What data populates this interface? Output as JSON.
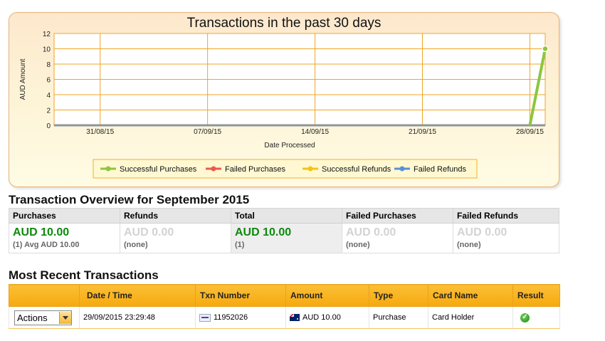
{
  "chart": {
    "title": "Transactions in the past 30 days",
    "ylabel": "AUD Amount",
    "xlabel": "Date Processed",
    "colors": {
      "successful_purchases": "#8cc63e",
      "failed_purchases": "#e85c4a",
      "successful_refunds": "#f5c312",
      "failed_refunds": "#5b8fd6",
      "grid": "#f0a626"
    }
  },
  "chart_data": {
    "type": "line",
    "title": "Transactions in the past 30 days",
    "xlabel": "Date Processed",
    "ylabel": "AUD Amount",
    "ylim": [
      0,
      12
    ],
    "yticks": [
      0,
      2,
      4,
      6,
      8,
      10,
      12
    ],
    "x_tick_labels": [
      "31/08/15",
      "07/09/15",
      "14/09/15",
      "21/09/15",
      "28/09/15"
    ],
    "x_start": "28/08/15",
    "x_end": "29/09/15",
    "grid": true,
    "legend_position": "bottom",
    "series": [
      {
        "name": "Successful Purchases",
        "points": [
          [
            "28/09/15",
            0
          ],
          [
            "29/09/15",
            10
          ]
        ]
      },
      {
        "name": "Failed Purchases",
        "points": [
          [
            "28/08/15",
            0
          ],
          [
            "29/09/15",
            0
          ]
        ]
      },
      {
        "name": "Successful Refunds",
        "points": [
          [
            "28/08/15",
            0
          ],
          [
            "29/09/15",
            0
          ]
        ]
      },
      {
        "name": "Failed Refunds",
        "points": [
          [
            "28/08/15",
            0
          ],
          [
            "29/09/15",
            0
          ]
        ]
      }
    ]
  },
  "overview": {
    "title": "Transaction Overview for September 2015",
    "columns": [
      {
        "header": "Purchases",
        "amount": "AUD 10.00",
        "sub": "(1) Avg AUD 10.00",
        "style": "green"
      },
      {
        "header": "Refunds",
        "amount": "AUD 0.00",
        "sub": "(none)",
        "style": "grey"
      },
      {
        "header": "Total",
        "amount": "AUD 10.00",
        "sub": "(1)",
        "style": "green"
      },
      {
        "header": "Failed Purchases",
        "amount": "AUD 0.00",
        "sub": "(none)",
        "style": "grey"
      },
      {
        "header": "Failed Refunds",
        "amount": "AUD 0.00",
        "sub": "(none)",
        "style": "grey"
      }
    ]
  },
  "recent": {
    "title": "Most Recent Transactions",
    "headers": [
      "",
      "Date / Time",
      "Txn Number",
      "Amount",
      "Type",
      "Card Name",
      "Result"
    ],
    "rows": [
      {
        "action": "Actions",
        "datetime": "29/09/2015 23:29:48",
        "txn": "11952026",
        "amount": "AUD 10.00",
        "type": "Purchase",
        "card_name": "Card Holder",
        "result_icon": "check-icon"
      }
    ]
  }
}
